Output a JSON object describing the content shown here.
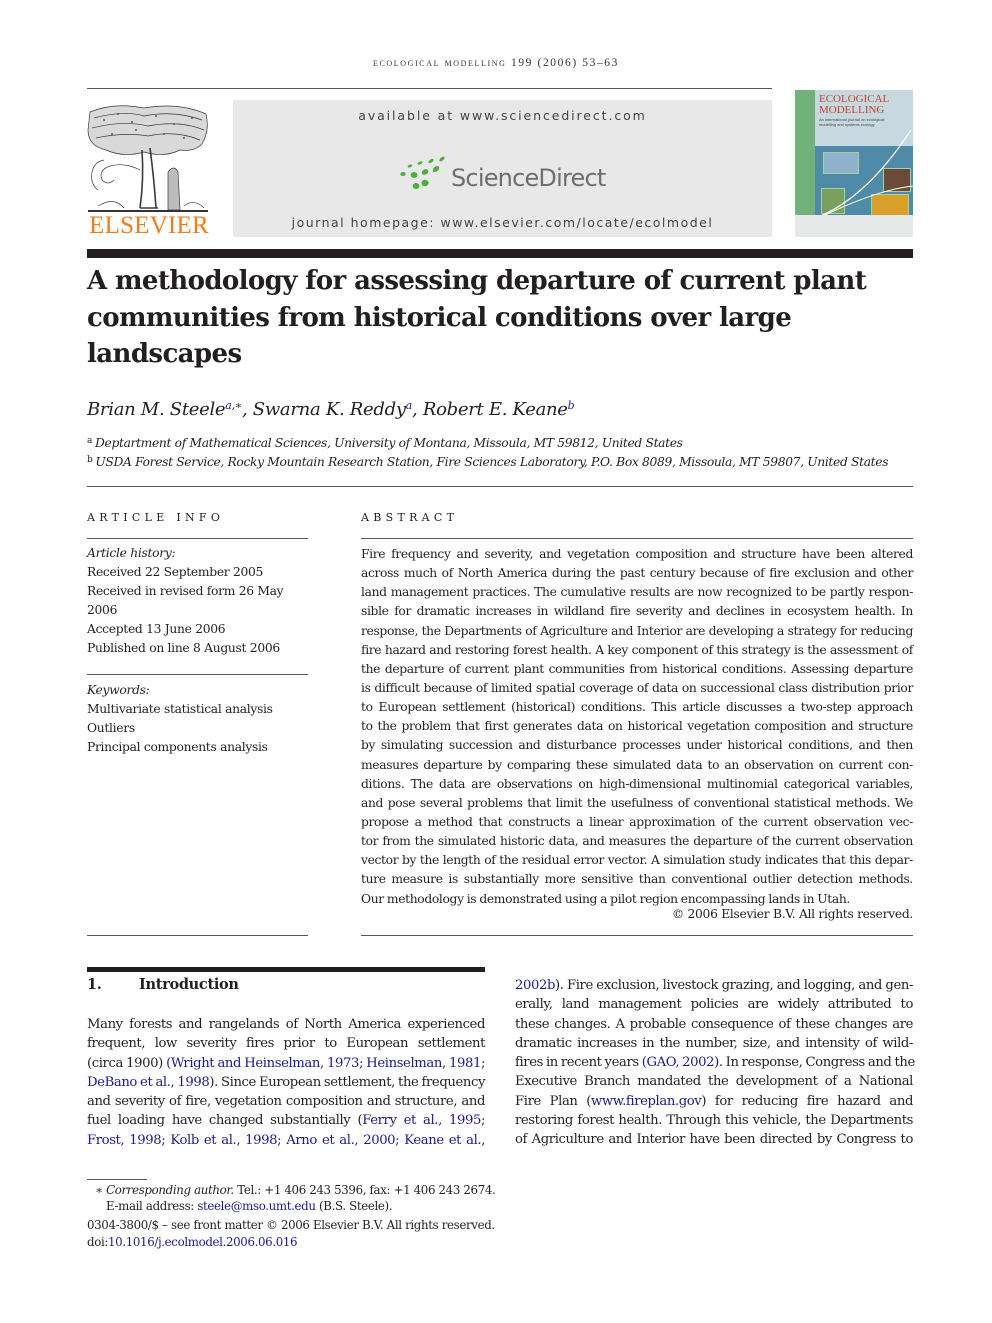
{
  "running_head": "ecological modelling 199 (2006) 53–63",
  "header": {
    "publisher_logo_text": "ELSEVIER",
    "publisher_logo_icon": "tree-engraving-icon",
    "available_at": "available at www.sciencedirect.com",
    "sciencedirect_wordmark": "ScienceDirect",
    "sciencedirect_icon": "sciencedirect-dots-icon",
    "journal_homepage": "journal homepage: www.elsevier.com/locate/ecolmodel",
    "cover": {
      "title_line1": "ECOLOGICAL",
      "title_line2": "MODELLING",
      "subtitle": "An international journal on ecological modelling and systems ecology"
    },
    "colors": {
      "elsevier_orange": "#f07d1d",
      "sciencedirect_green": "#4caf3c",
      "link_blue": "#1a1a8c",
      "box_gray": "#e8e8e8"
    }
  },
  "article": {
    "title": "A methodology for assessing departure of current plant communities from historical conditions over large landscapes",
    "title_lines": [
      "A methodology for assessing departure of current plant",
      "communities from historical conditions over large",
      "landscapes"
    ],
    "authors": [
      {
        "name": "Brian M. Steele",
        "affil": "a,",
        "corresponding": "∗"
      },
      {
        "name": "Swarna K. Reddy",
        "affil": "a",
        "corresponding": ""
      },
      {
        "name": "Robert E. Keane",
        "affil": "b",
        "corresponding": ""
      }
    ],
    "author_separator": ", ",
    "affiliations": [
      {
        "mark": "a",
        "text": "Deptartment of Mathematical Sciences, University of Montana, Missoula, MT 59812, United States"
      },
      {
        "mark": "b",
        "text": "USDA Forest Service, Rocky Mountain Research Station, Fire Sciences Laboratory, P.O. Box 8089, Missoula, MT 59807, United States"
      }
    ]
  },
  "article_info": {
    "heading": "ARTICLE INFO",
    "history_label": "Article history:",
    "history": [
      "Received 22 September 2005",
      "Received in revised form 26 May",
      "2006",
      "Accepted 13 June 2006",
      "Published on line 8 August 2006"
    ],
    "keywords_label": "Keywords:",
    "keywords": [
      "Multivariate statistical analysis",
      "Outliers",
      "Principal components analysis"
    ]
  },
  "abstract": {
    "heading": "ABSTRACT",
    "lines": [
      "Fire frequency and severity, and vegetation composition and structure have been altered",
      "across much of North America during the past century because of fire exclusion and other",
      "land management practices. The cumulative results are now recognized to be partly respon-",
      "sible for dramatic increases in wildland fire severity and declines in ecosystem health. In",
      "response, the Departments of Agriculture and Interior are developing a strategy for reducing",
      "fire hazard and restoring forest health. A key component of this strategy is the assessment of",
      "the departure of current plant communities from historical conditions. Assessing departure",
      "is difficult because of limited spatial coverage of data on successional class distribution prior",
      "to European settlement (historical) conditions. This article discusses a two-step approach",
      "to the problem that first generates data on historical vegetation composition and structure",
      "by simulating succession and disturbance processes under historical conditions, and then",
      "measures departure by comparing these simulated data to an observation on current con-",
      "ditions. The data are observations on high-dimensional multinomial categorical variables,",
      "and pose several problems that limit the usefulness of conventional statistical methods. We",
      "propose a method that constructs a linear approximation of the current observation vec-",
      "tor from the simulated historic data, and measures the departure of the current observation",
      "vector by the length of the residual error vector. A simulation study indicates that this depar-",
      "ture measure is substantially more sensitive than conventional outlier detection methods.",
      "Our methodology is demonstrated using a pilot region encompassing lands in Utah."
    ],
    "copyright": "© 2006 Elsevier B.V. All rights reserved."
  },
  "introduction": {
    "number": "1.",
    "heading": "Introduction",
    "left_column": [
      {
        "segments": [
          {
            "t": "Many forests and rangelands of North America experienced"
          }
        ]
      },
      {
        "segments": [
          {
            "t": "frequent, low severity fires prior to European settlement"
          }
        ]
      },
      {
        "segments": [
          {
            "t": "(circa 1900) "
          },
          {
            "t": "(Wright and Heinselman, 1973; Heinselman, 1981;",
            "link": true
          }
        ]
      },
      {
        "segments": [
          {
            "t": "DeBano et al., 1998",
            "link": true
          },
          {
            "t": "). Since European settlement, the frequency"
          }
        ]
      },
      {
        "segments": [
          {
            "t": "and severity of fire, vegetation composition and structure, and"
          }
        ]
      },
      {
        "segments": [
          {
            "t": "fuel loading have changed substantially ("
          },
          {
            "t": "Ferry et al., 1995;",
            "link": true
          }
        ]
      },
      {
        "segments": [
          {
            "t": "Frost, 1998; Kolb et al., 1998; Arno et al., 2000; Keane et al.,",
            "link": true
          }
        ]
      }
    ],
    "right_column": [
      {
        "segments": [
          {
            "t": "2002b",
            "link": true
          },
          {
            "t": "). Fire exclusion, livestock grazing, and logging, and gen-"
          }
        ]
      },
      {
        "segments": [
          {
            "t": "erally, land management policies are widely attributed to"
          }
        ]
      },
      {
        "segments": [
          {
            "t": "these changes. A probable consequence of these changes are"
          }
        ]
      },
      {
        "segments": [
          {
            "t": "dramatic increases in the number, size, and intensity of wild-"
          }
        ]
      },
      {
        "segments": [
          {
            "t": "fires in recent years "
          },
          {
            "t": "(GAO, 2002)",
            "link": true
          },
          {
            "t": ". In response, Congress and the"
          }
        ]
      },
      {
        "segments": [
          {
            "t": "Executive Branch mandated the development of a National"
          }
        ]
      },
      {
        "segments": [
          {
            "t": "Fire Plan ("
          },
          {
            "t": "www.fireplan.gov",
            "link": true
          },
          {
            "t": ") for reducing fire hazard and"
          }
        ]
      },
      {
        "segments": [
          {
            "t": "restoring forest health. Through this vehicle, the Departments"
          }
        ]
      },
      {
        "segments": [
          {
            "t": "of Agriculture and Interior have been directed by Congress to"
          }
        ]
      }
    ]
  },
  "footnotes": {
    "corresponding_mark": "∗",
    "corresponding_label": "Corresponding author.",
    "corresponding_contact": " Tel.: +1 406 243 5396, fax: +1 406 243 2674.",
    "email_label": "E-mail address: ",
    "email": "steele@mso.umt.edu",
    "email_owner": " (B.S. Steele).",
    "front_matter": "0304-3800/$ – see front matter © 2006 Elsevier B.V. All rights reserved.",
    "doi_label": "doi:",
    "doi": "10.1016/j.ecolmodel.2006.06.016"
  }
}
